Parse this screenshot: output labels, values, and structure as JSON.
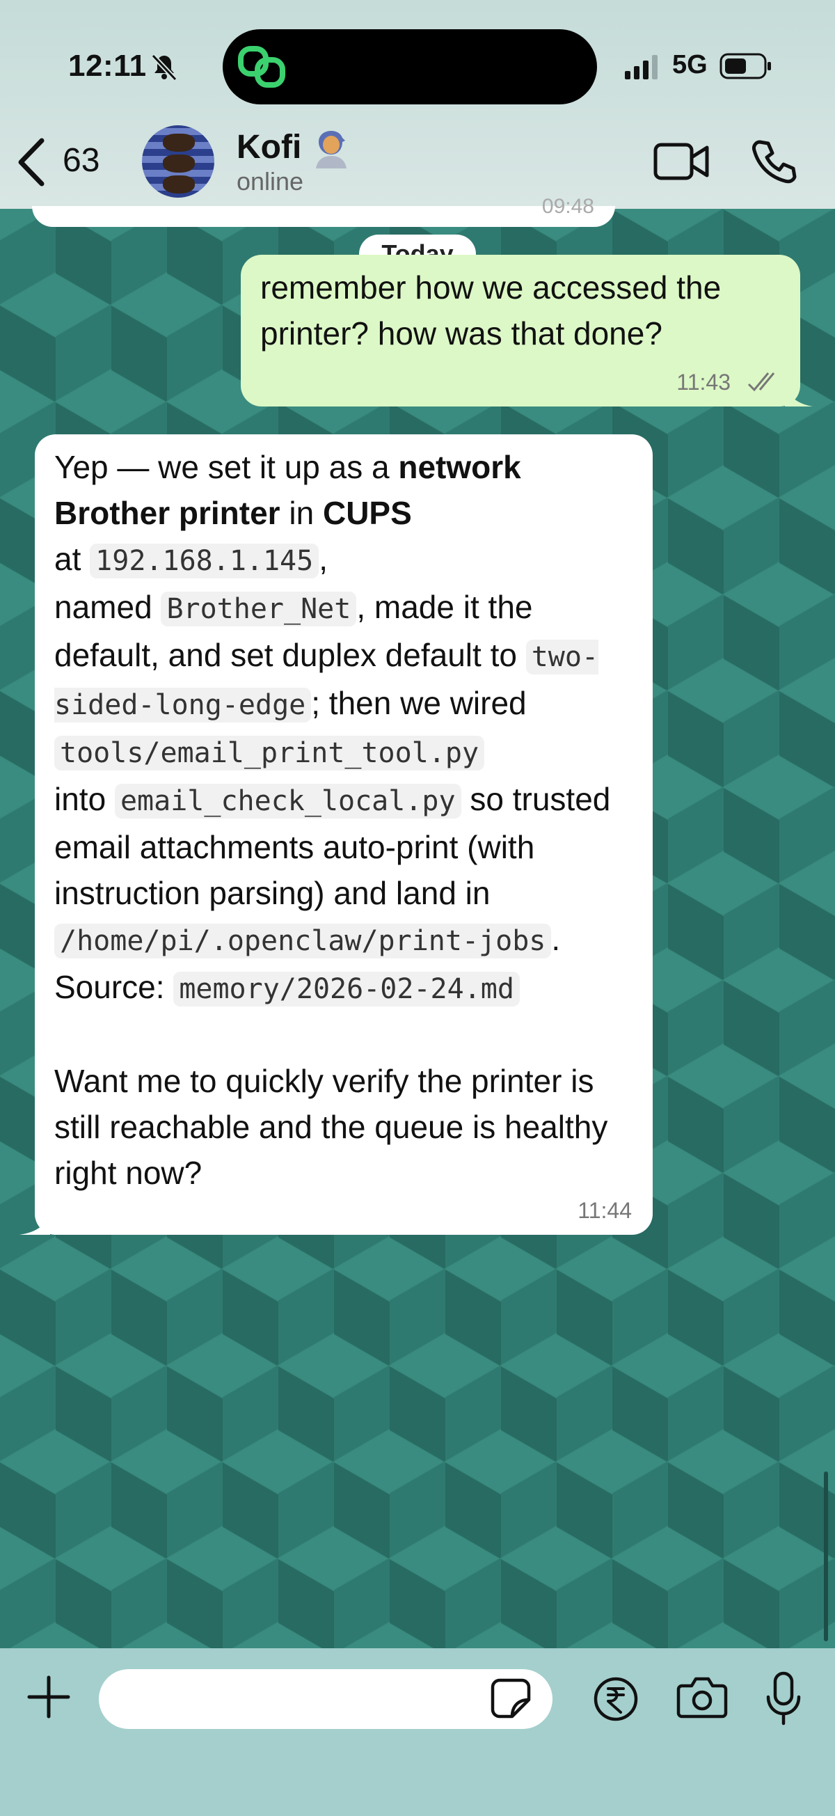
{
  "status_bar": {
    "time": "12:11",
    "network": "5G",
    "icons": [
      "bell-slash-icon",
      "app-link-icon",
      "signal-icon",
      "battery-icon"
    ]
  },
  "header": {
    "back_count": "63",
    "contact_name": "Kofi",
    "contact_status": "online",
    "icons": [
      "chevron-left-icon",
      "avatar",
      "person-emoji-icon",
      "video-call-icon",
      "phone-call-icon"
    ]
  },
  "chat": {
    "previous_time_partial": "09:48",
    "date_separator": "Today",
    "outgoing": {
      "text": "remember how we accessed the printer? how was that done?",
      "time": "11:43",
      "status_icon": "double-check-icon"
    },
    "incoming": {
      "p1_a": "Yep — we set it up as a ",
      "p1_bold1": "network Brother printer",
      "p1_b": " in ",
      "p1_bold2": "CUPS",
      "p1_c": " at ",
      "code_ip": "192.168.1.145",
      "p1_d": ", named ",
      "code_name": "Brother_Net",
      "p1_e": ", made it the default, and set duplex default to ",
      "code_duplex": "two-sided-long-edge",
      "p1_f": "; then we wired ",
      "code_tool": "tools/email_print_tool.py",
      "p1_g": " into ",
      "code_check": "email_check_local.py",
      "p1_h": " so trusted email attachments auto-print (with instruction parsing) and land in ",
      "code_path": "/home/pi/.openclaw/print-jobs",
      "p1_i": ".",
      "source_label": "Source: ",
      "code_source": "memory/2026-02-24.md",
      "p2": "Want me to quickly verify the printer is still reachable and the queue is healthy right now?",
      "time": "11:44"
    }
  },
  "composer": {
    "placeholder": "",
    "icons": [
      "plus-icon",
      "sticker-icon",
      "rupee-payment-icon",
      "camera-icon",
      "microphone-icon"
    ]
  },
  "colors": {
    "outgoing_bubble": "#dcf8c6",
    "incoming_bubble": "#ffffff",
    "wallpaper": "#2f7a70",
    "composer_bg": "#a4cfcd"
  }
}
